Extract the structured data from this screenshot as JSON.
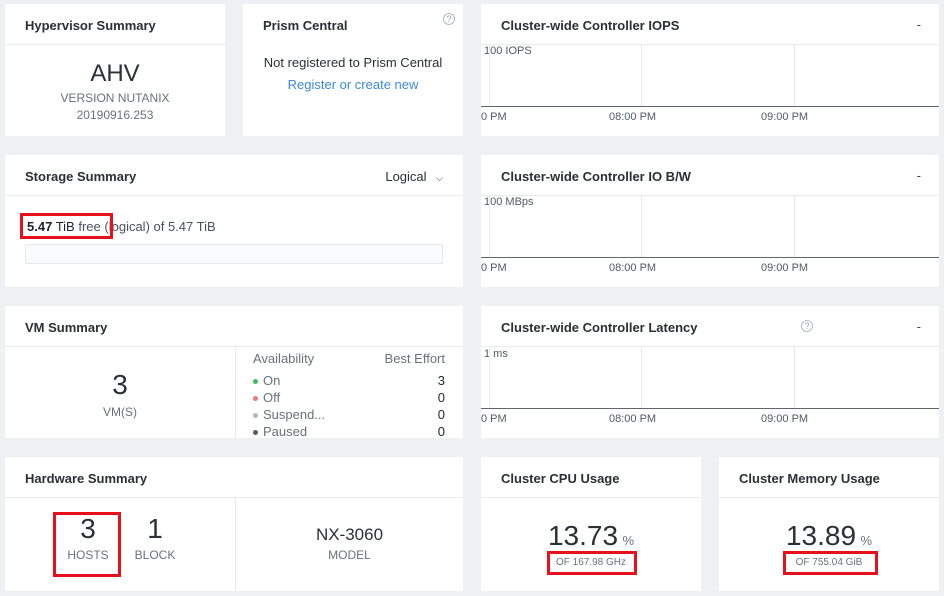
{
  "hypervisor": {
    "title": "Hypervisor Summary",
    "name": "AHV",
    "version_line1": "VERSION NUTANIX",
    "version_line2": "20190916.253"
  },
  "prism": {
    "title": "Prism Central",
    "help": "?",
    "status": "Not registered to Prism Central",
    "link": "Register or create new"
  },
  "storage": {
    "title": "Storage Summary",
    "dropdown": "Logical",
    "free_value": "5.47",
    "free_unit": "TiB",
    "free_word": "free",
    "suffix": "(logical) of 5.47 TiB",
    "used_fraction": 0
  },
  "vm": {
    "title": "VM Summary",
    "count": "3",
    "count_label": "VM(S)",
    "col_availability": "Availability",
    "col_best_effort": "Best Effort",
    "rows": [
      {
        "label": "On",
        "value": "3",
        "color": "#3fbf5f"
      },
      {
        "label": "Off",
        "value": "0",
        "color": "#f07a7a"
      },
      {
        "label": "Suspend...",
        "value": "0",
        "color": "#b3b9c2"
      },
      {
        "label": "Paused",
        "value": "0",
        "color": "#555d68"
      }
    ]
  },
  "hardware": {
    "title": "Hardware Summary",
    "hosts": "3",
    "hosts_label": "HOSTS",
    "blocks": "1",
    "block_label": "BLOCK",
    "model": "NX-3060",
    "model_label": "MODEL"
  },
  "iops": {
    "title": "Cluster-wide Controller IOPS",
    "menu": "-",
    "y_label": "100 IOPS",
    "x_ticks": [
      "0 PM",
      "08:00 PM",
      "09:00 PM"
    ]
  },
  "iobw": {
    "title": "Cluster-wide Controller IO B/W",
    "menu": "-",
    "y_label": "100 MBps",
    "x_ticks": [
      "0 PM",
      "08:00 PM",
      "09:00 PM"
    ]
  },
  "latency": {
    "title": "Cluster-wide Controller Latency",
    "help": "?",
    "menu": "-",
    "y_label": "1 ms",
    "x_ticks": [
      "0 PM",
      "08:00 PM",
      "09:00 PM"
    ]
  },
  "cpu": {
    "title": "Cluster CPU Usage",
    "value": "13.73",
    "unit": "%",
    "of": "OF 167.98 GHz"
  },
  "memory": {
    "title": "Cluster Memory Usage",
    "value": "13.89",
    "unit": "%",
    "of": "OF 755.04 GiB"
  },
  "colors": {
    "highlight": "#e8101a",
    "link": "#3b8bd4",
    "background": "#eef0f3"
  }
}
